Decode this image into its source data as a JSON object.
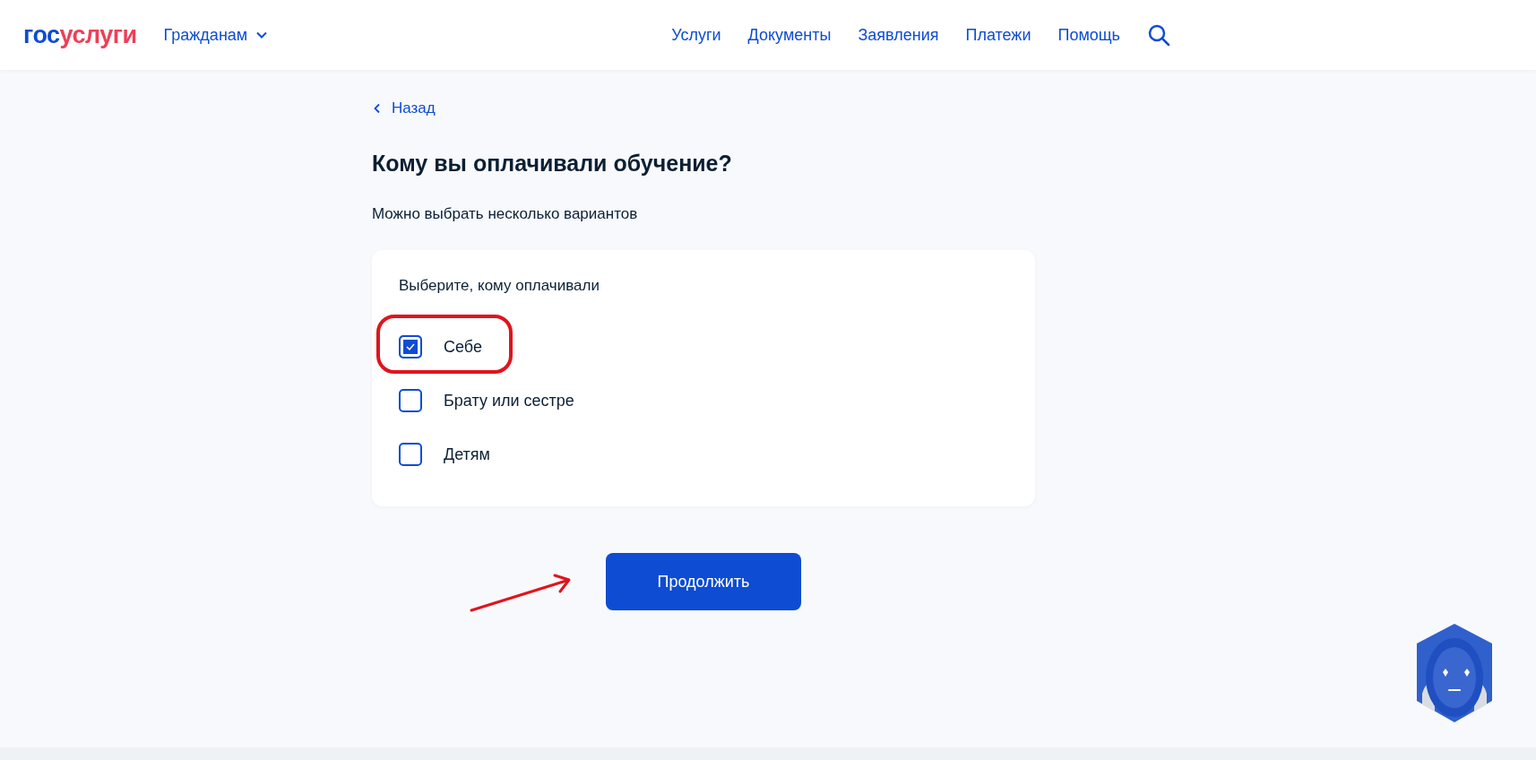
{
  "header": {
    "logo": {
      "part_1": "гос",
      "part_2": "услуги"
    },
    "audience": {
      "label": "Гражданам",
      "expanded": false
    },
    "nav": [
      {
        "label": "Услуги"
      },
      {
        "label": "Документы"
      },
      {
        "label": "Заявления"
      },
      {
        "label": "Платежи"
      },
      {
        "label": "Помощь"
      }
    ]
  },
  "back_link": "Назад",
  "title": "Кому вы оплачивали обучение?",
  "hint": "Можно выбрать несколько вариантов",
  "card": {
    "label": "Выберите, кому оплачивали",
    "options": [
      {
        "label": "Себе",
        "checked": true,
        "highlighted": true
      },
      {
        "label": "Брату или сестре",
        "checked": false,
        "highlighted": false
      },
      {
        "label": "Детям",
        "checked": false,
        "highlighted": false
      }
    ]
  },
  "continue_button": "Продолжить"
}
